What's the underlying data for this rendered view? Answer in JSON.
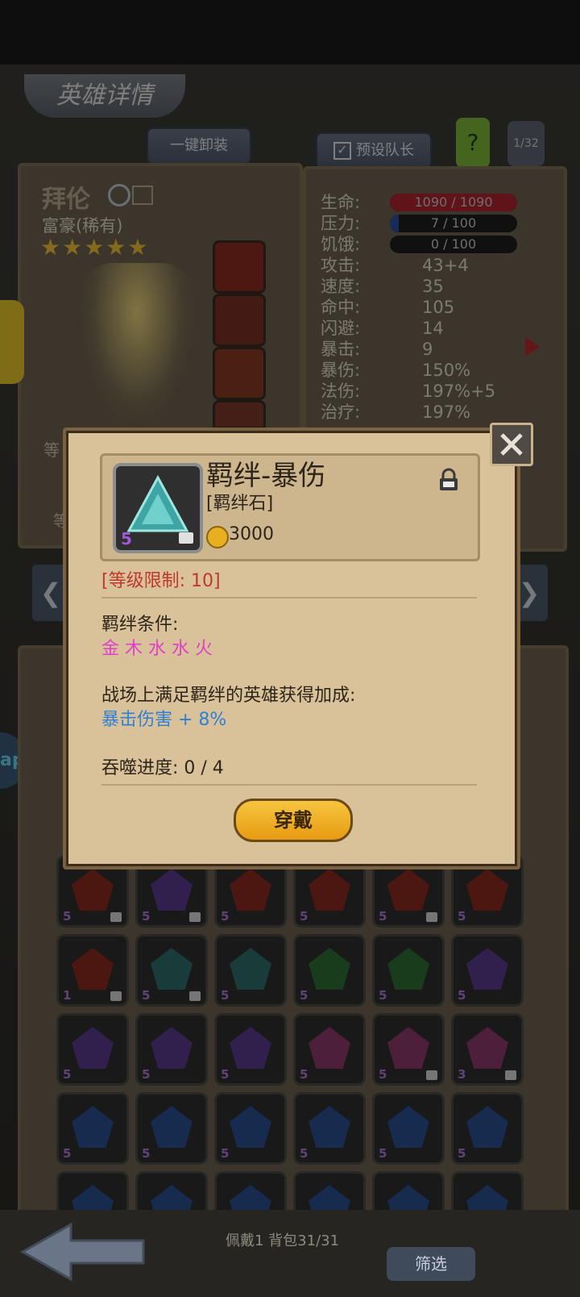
{
  "header": {
    "title": "英雄详情"
  },
  "toolbar": {
    "unequip_all": "一键卸装",
    "preset_team": "预设队长",
    "help": "?",
    "page_counter": "1/32"
  },
  "hero": {
    "name": "拜伦",
    "class_rarity": "富豪(稀有)",
    "stars": 5,
    "level_label": "等",
    "level_label2": "等"
  },
  "stats": [
    {
      "label": "生命:",
      "value": "1090 / 1090",
      "kind": "bar",
      "color": "#b0232e",
      "fill": 1.0
    },
    {
      "label": "压力:",
      "value": "7 / 100",
      "kind": "bar",
      "color": "#2a4ea0",
      "fill": 0.07
    },
    {
      "label": "饥饿:",
      "value": "0 / 100",
      "kind": "bar",
      "color": "#555555",
      "fill": 0.0
    },
    {
      "label": "攻击:",
      "value": "43+4"
    },
    {
      "label": "速度:",
      "value": "35"
    },
    {
      "label": "命中:",
      "value": "105"
    },
    {
      "label": "闪避:",
      "value": "14"
    },
    {
      "label": "暴击:",
      "value": "9"
    },
    {
      "label": "暴伤:",
      "value": "150%"
    },
    {
      "label": "法伤:",
      "value": "197%+5"
    },
    {
      "label": "治疗:",
      "value": "197%"
    }
  ],
  "dialog": {
    "item_name": "羁绊-暴伤",
    "item_type": "[羁绊石]",
    "price": "3000",
    "item_level": "5",
    "level_limit": "[等级限制: 10]",
    "bond_condition_label": "羁绊条件:",
    "bond_condition_value": "金 木 水 水 火",
    "bonus_label": "战场上满足羁绊的英雄获得加成:",
    "bonus_value": "暴击伤害 + 8%",
    "devour_progress": "吞噬进度:  0 / 4",
    "wear_button": "穿戴"
  },
  "colors": {
    "level_limit": "#c0392b",
    "condition": "#e040c8",
    "bonus": "#2f7fd6",
    "coin": "#e8b020"
  },
  "gem_grid": [
    [
      {
        "c": "#8a2a1f",
        "n": "5",
        "lock": true
      },
      {
        "c": "#5a3a8e",
        "n": "5",
        "lock": true
      },
      {
        "c": "#8a2a1f",
        "n": "5",
        "lock": false
      },
      {
        "c": "#8a2a1f",
        "n": "5",
        "lock": false
      },
      {
        "c": "#8a2a1f",
        "n": "5",
        "lock": true
      },
      {
        "c": "#8a2a1f",
        "n": "5",
        "lock": false
      }
    ],
    [
      {
        "c": "#8a2a1f",
        "n": "1",
        "lock": true
      },
      {
        "c": "#2f6d6a",
        "n": "5",
        "lock": true
      },
      {
        "c": "#2f6d6a",
        "n": "5",
        "lock": false
      },
      {
        "c": "#2d6e33",
        "n": "5",
        "lock": false
      },
      {
        "c": "#2d6e33",
        "n": "5",
        "lock": false
      },
      {
        "c": "#5a3a8e",
        "n": "5",
        "lock": false
      }
    ],
    [
      {
        "c": "#5a3a8e",
        "n": "5",
        "lock": false
      },
      {
        "c": "#5a3a8e",
        "n": "5",
        "lock": false
      },
      {
        "c": "#5a3a8e",
        "n": "5",
        "lock": false
      },
      {
        "c": "#8e3a6a",
        "n": "5",
        "lock": false
      },
      {
        "c": "#8e3a6a",
        "n": "5",
        "lock": true
      },
      {
        "c": "#8e3a6a",
        "n": "3",
        "lock": true
      }
    ],
    [
      {
        "c": "#2a4f8e",
        "n": "5",
        "lock": false
      },
      {
        "c": "#2a4f8e",
        "n": "5",
        "lock": false
      },
      {
        "c": "#2a4f8e",
        "n": "5",
        "lock": false
      },
      {
        "c": "#2a4f8e",
        "n": "5",
        "lock": false
      },
      {
        "c": "#2a4f8e",
        "n": "5",
        "lock": false
      },
      {
        "c": "#2a4f8e",
        "n": "5",
        "lock": false
      }
    ],
    [
      {
        "c": "#2a4f8e",
        "n": "",
        "lock": false
      },
      {
        "c": "#2a4f8e",
        "n": "",
        "lock": false
      },
      {
        "c": "#2a4f8e",
        "n": "",
        "lock": false
      },
      {
        "c": "#2a4f8e",
        "n": "",
        "lock": false
      },
      {
        "c": "#2a4f8e",
        "n": "",
        "lock": false
      },
      {
        "c": "#2a4f8e",
        "n": "",
        "lock": false
      }
    ]
  ],
  "footer": {
    "bag_status": "佩戴1 背包31/31",
    "filter_button": "筛选"
  },
  "side": {
    "app_badge": "ap"
  }
}
